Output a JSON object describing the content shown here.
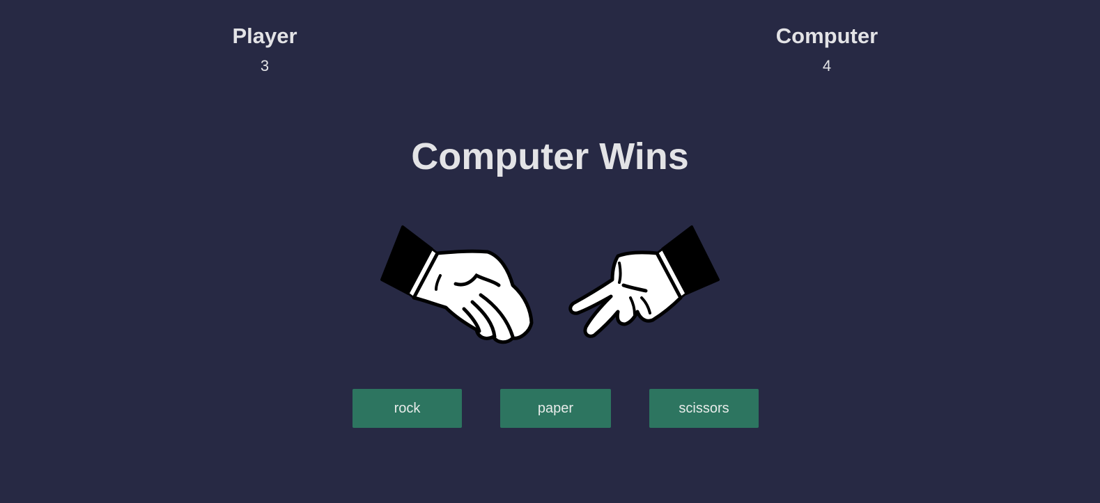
{
  "scoreboard": {
    "player": {
      "label": "Player",
      "score": "3"
    },
    "computer": {
      "label": "Computer",
      "score": "4"
    }
  },
  "result": {
    "message": "Computer Wins"
  },
  "hands": {
    "player_choice_icon": "rock-hand-icon",
    "computer_choice_icon": "scissors-hand-icon"
  },
  "choices": {
    "rock_label": "rock",
    "paper_label": "paper",
    "scissors_label": "scissors"
  },
  "colors": {
    "background": "#272944",
    "text": "#e3e3e6",
    "button": "#2d7560"
  }
}
